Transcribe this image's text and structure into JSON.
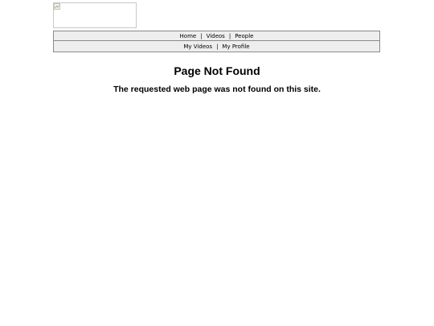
{
  "nav": {
    "primary": [
      "Home",
      "Videos",
      "People"
    ],
    "secondary": [
      "My Videos",
      "My Profile"
    ],
    "separator": "|"
  },
  "main": {
    "title": "Page Not Found",
    "message": "The requested web page was not found on this site."
  },
  "logo": {
    "icon": "broken-image-icon"
  }
}
